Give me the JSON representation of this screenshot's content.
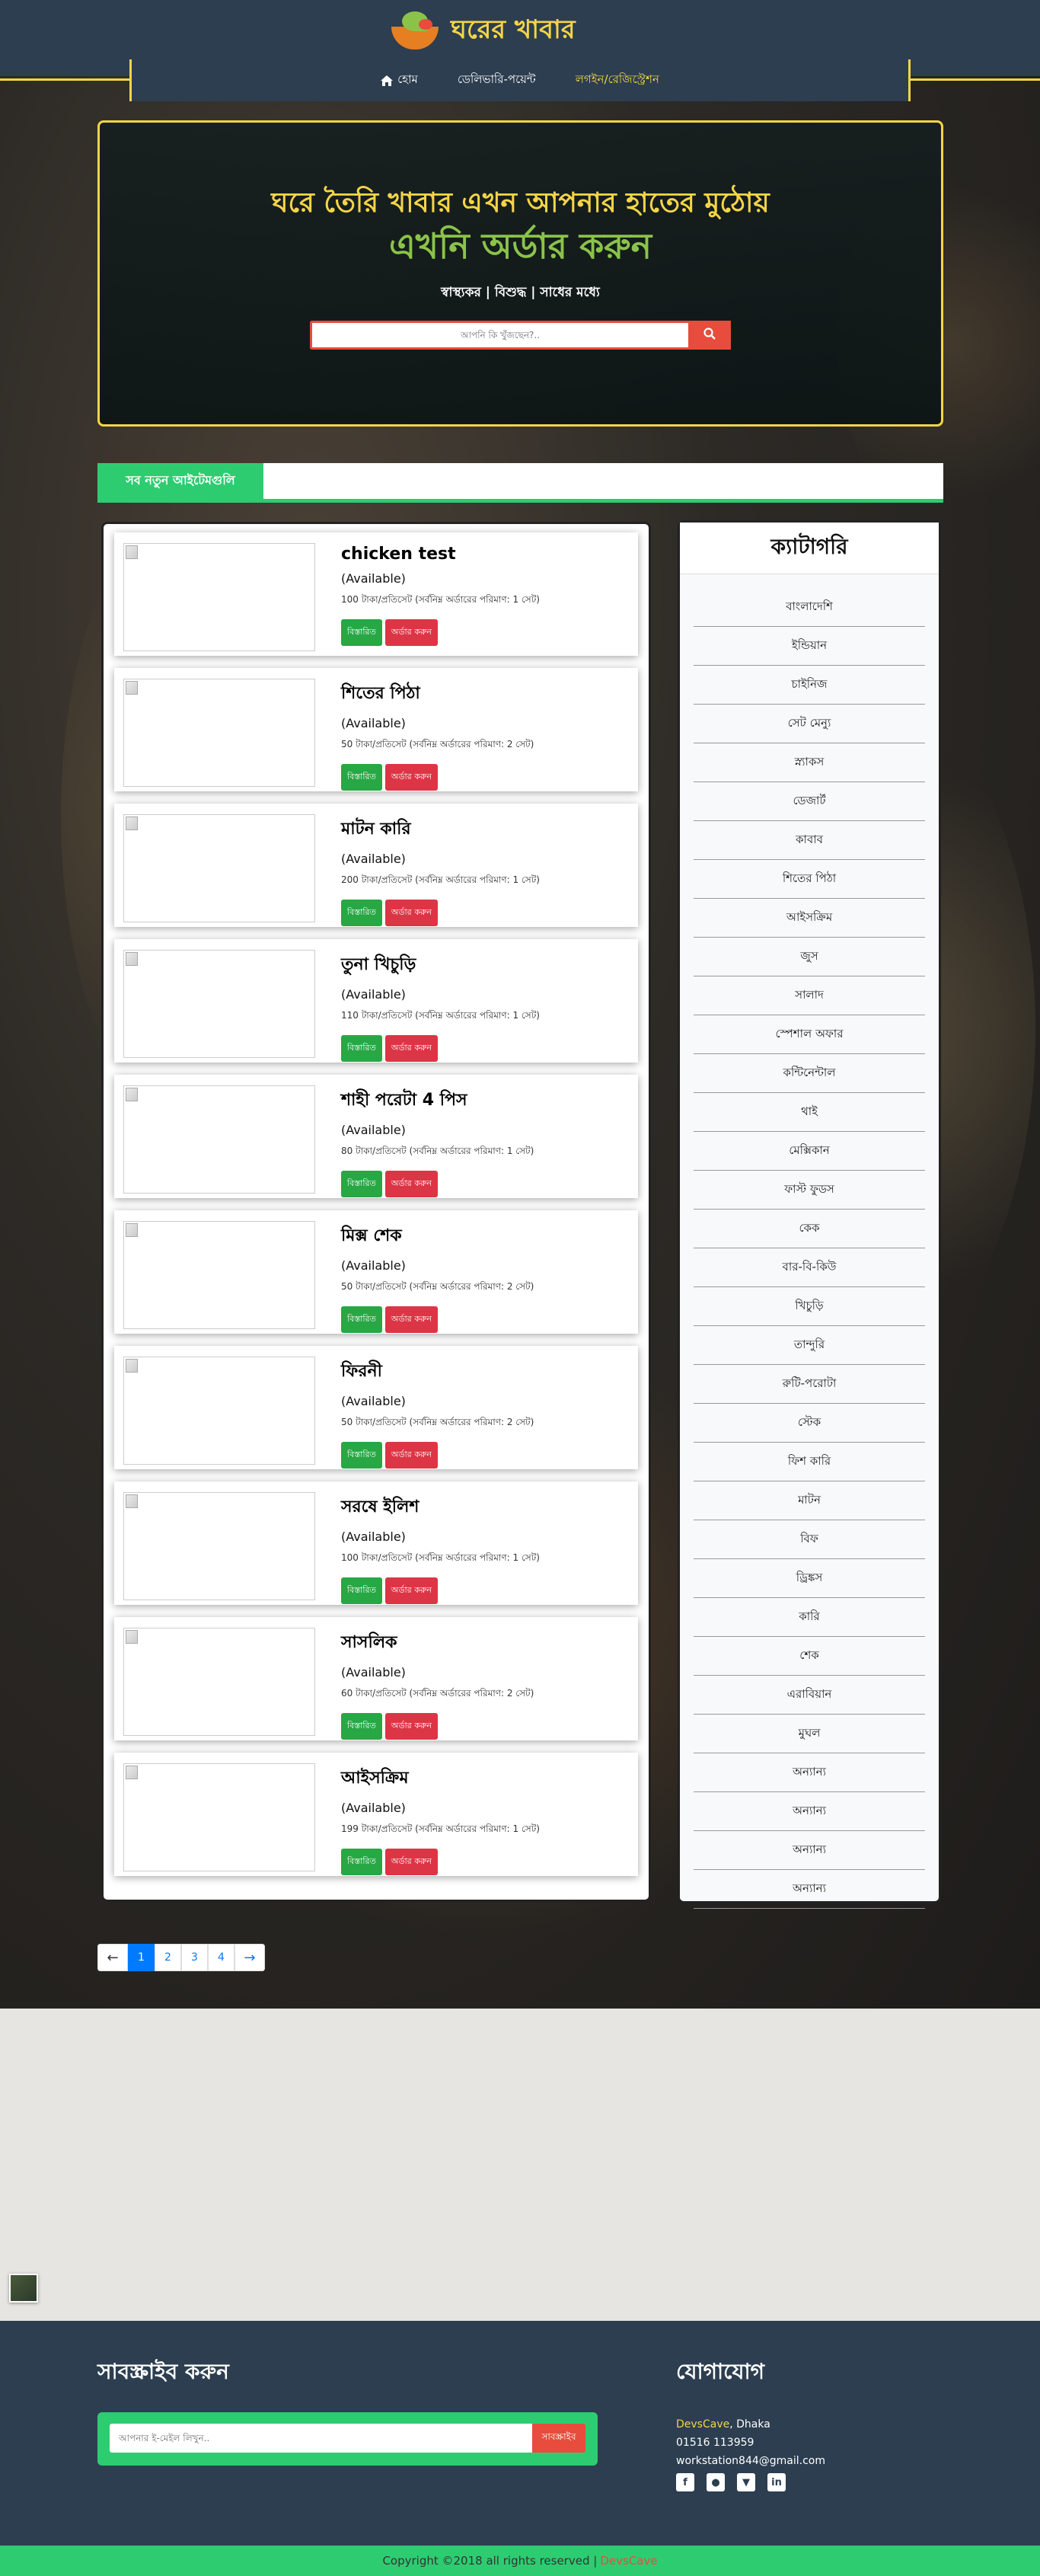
{
  "brand": {
    "title": "ঘরের খাবার"
  },
  "nav": {
    "home": "হোম",
    "delivery": "ডেলিভারি-পয়েন্ট",
    "login": "লগইন/রেজিস্ট্রেশন"
  },
  "hero": {
    "line1": "ঘরে তৈরি খাবার এখন আপনার হাতের মুঠোয়",
    "line2": "এখনি অর্ডার করুন",
    "tagline": "স্বাস্থ্যকর | বিশুদ্ধ | সাধের মধ্যে",
    "search_placeholder": "আপনি কি খুঁজছেন?.."
  },
  "ticker": {
    "label": "সব নতুন আইটেমগুলি"
  },
  "items": [
    {
      "name": "chicken test",
      "status": "(Available)",
      "price": "100 টাকা/প্রতিসেট (সর্বনিম্ন অর্ডারের পরিমাণ: 1 সেট)"
    },
    {
      "name": "শিতের পিঠা",
      "status": "(Available)",
      "price": "50 টাকা/প্রতিসেট (সর্বনিম্ন অর্ডারের পরিমাণ: 2 সেট)"
    },
    {
      "name": "মাটন কারি",
      "status": "(Available)",
      "price": "200 টাকা/প্রতিসেট (সর্বনিম্ন অর্ডারের পরিমাণ: 1 সেট)"
    },
    {
      "name": "তুনা খিচুড়ি",
      "status": "(Available)",
      "price": "110 টাকা/প্রতিসেট (সর্বনিম্ন অর্ডারের পরিমাণ: 1 সেট)"
    },
    {
      "name": "শাহী পরেটা 4 পিস",
      "status": "(Available)",
      "price": "80 টাকা/প্রতিসেট (সর্বনিম্ন অর্ডারের পরিমাণ: 1 সেট)"
    },
    {
      "name": "মিক্স শেক",
      "status": "(Available)",
      "price": "50 টাকা/প্রতিসেট (সর্বনিম্ন অর্ডারের পরিমাণ: 2 সেট)"
    },
    {
      "name": "ফিরনী",
      "status": "(Available)",
      "price": "50 টাকা/প্রতিসেট (সর্বনিম্ন অর্ডারের পরিমাণ: 2 সেট)"
    },
    {
      "name": "সরষে ইলিশ",
      "status": "(Available)",
      "price": "100 টাকা/প্রতিসেট (সর্বনিম্ন অর্ডারের পরিমাণ: 1 সেট)"
    },
    {
      "name": "সাসলিক",
      "status": "(Available)",
      "price": "60 টাকা/প্রতিসেট (সর্বনিম্ন অর্ডারের পরিমাণ: 2 সেট)"
    },
    {
      "name": "আইসক্রিম",
      "status": "(Available)",
      "price": "199 টাকা/প্রতিসেট (সর্বনিম্ন অর্ডারের পরিমাণ: 1 সেট)"
    }
  ],
  "item_buttons": {
    "details": "বিস্তারিত",
    "order": "অর্ডার করুন"
  },
  "categories": {
    "title": "ক্যাটাগরি",
    "list": [
      "বাংলাদেশি",
      "ইন্ডিয়ান",
      "চাইনিজ",
      "সেট মেন্যু",
      "স্ন্যাকস",
      "ডেজার্ট",
      "কাবাব",
      "শিতের পিঠা",
      "আইসক্রিম",
      "জুস",
      "সালাদ",
      "স্পেশাল অফার",
      "কন্টিনেন্টাল",
      "থাই",
      "মেক্সিকান",
      "ফাস্ট ফুডস",
      "কেক",
      "বার-বি-কিউ",
      "খিচুড়ি",
      "তান্দুরি",
      "রুটি-পরোটা",
      "স্টেক",
      "ফিশ কারি",
      "মাটন",
      "বিফ",
      "ড্রিঙ্কস",
      "কারি",
      "শেক",
      "এরাবিয়ান",
      "মুঘল",
      "অন্যান্য",
      "অন্যান্য",
      "অন্যান্য",
      "অন্যান্য"
    ]
  },
  "pagination": {
    "pages": [
      "1",
      "2",
      "3",
      "4"
    ],
    "current": "1",
    "prev": "←",
    "next": "→"
  },
  "footer": {
    "subscribe_title": "সাবস্ক্রাইব করুন",
    "subscribe_placeholder": "আপনার ই-মেইল লিখুন..",
    "subscribe_button": "সাবস্ক্রাইব",
    "contact_title": "যোগাযোগ",
    "contact_brand": "DevsCave",
    "contact_city": ", Dhaka",
    "contact_phone": "01516 113959",
    "contact_email": "workstation844@gmail.com",
    "social_icons": [
      "facebook-icon",
      "github-icon",
      "pocket-icon",
      "linkedin-icon"
    ]
  },
  "copyright": {
    "text": "Copyright ©2018 all rights reserved |",
    "brand": "DevsCave"
  },
  "colors": {
    "navy": "#2c3e50",
    "yellow": "#f5d547",
    "green": "#2ecc71",
    "red": "#e74c3c",
    "lime": "#8bc34a"
  }
}
